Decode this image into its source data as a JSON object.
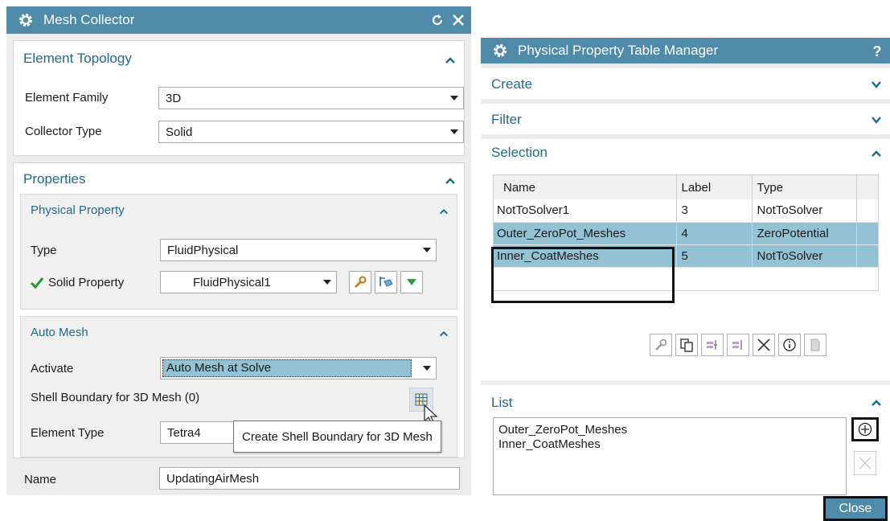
{
  "mesh_collector": {
    "title": "Mesh Collector",
    "element_topology": {
      "title": "Element Topology",
      "element_family_label": "Element Family",
      "element_family_value": "3D",
      "collector_type_label": "Collector Type",
      "collector_type_value": "Solid"
    },
    "properties": {
      "title": "Properties",
      "physical_property": {
        "title": "Physical Property",
        "type_label": "Type",
        "type_value": "FluidPhysical",
        "solid_property_label": "Solid Property",
        "solid_property_value": "FluidPhysical1"
      },
      "auto_mesh": {
        "title": "Auto Mesh",
        "activate_label": "Activate",
        "activate_value": "Auto Mesh at Solve",
        "shell_boundary_label": "Shell Boundary for 3D Mesh (0)",
        "element_type_label": "Element Type",
        "element_type_value": "Tetra4"
      }
    },
    "name_label": "Name",
    "name_value": "UpdatingAirMesh",
    "tooltip": "Create Shell Boundary for 3D Mesh"
  },
  "property_manager": {
    "title": "Physical Property Table Manager",
    "help": "?",
    "sections": {
      "create": "Create",
      "filter": "Filter",
      "selection": "Selection",
      "list": "List"
    },
    "columns": [
      "Name",
      "Label",
      "Type"
    ],
    "rows": [
      {
        "name": "NotToSolver1",
        "label": "3",
        "type": "NotToSolver"
      },
      {
        "name": "Outer_ZeroPot_Meshes",
        "label": "4",
        "type": "ZeroPotential"
      },
      {
        "name": "Inner_CoatMeshes",
        "label": "5",
        "type": "NotToSolver"
      }
    ],
    "list_items": [
      "Outer_ZeroPot_Meshes",
      "Inner_CoatMeshes"
    ],
    "close_label": "Close"
  },
  "colors": {
    "title_bar": "#4f8aa8",
    "section_text": "#1d6a8c",
    "highlight": "#92c2d3"
  }
}
